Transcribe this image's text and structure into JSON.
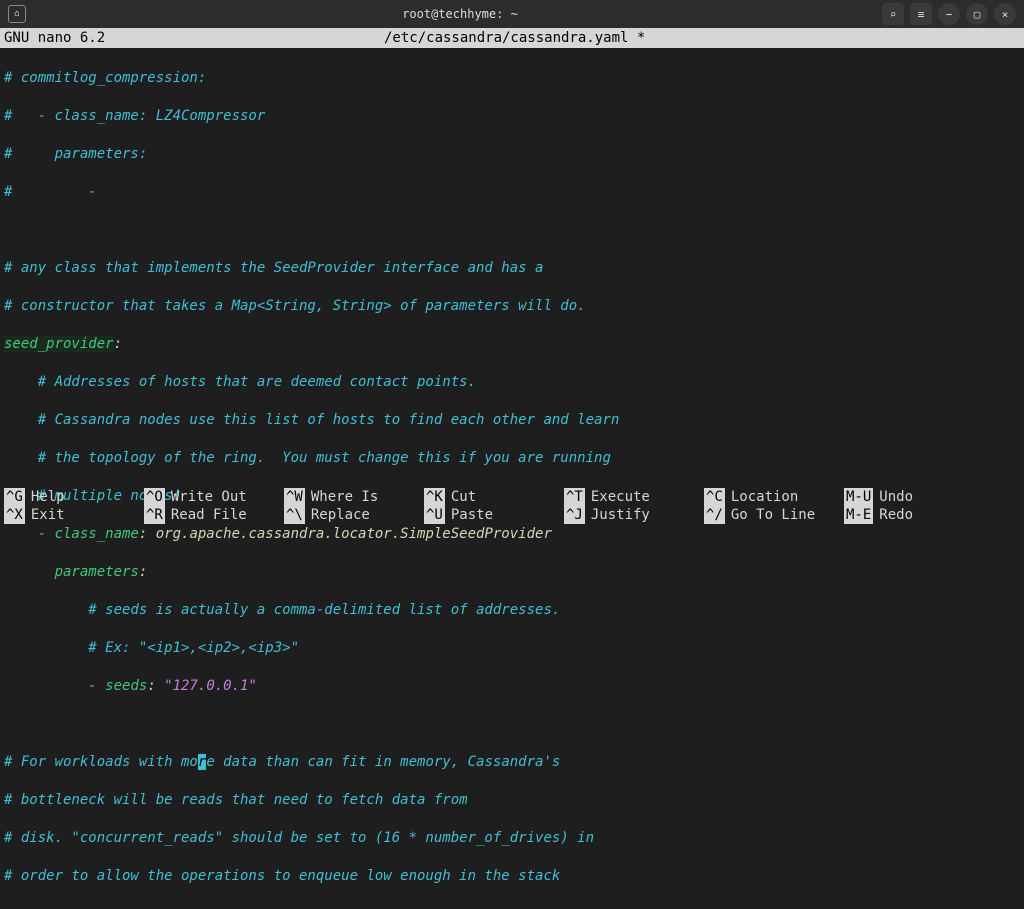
{
  "titlebar": {
    "window_title": "root@techhyme: ~"
  },
  "nano": {
    "app_version": " GNU nano 6.2",
    "file_path": "/etc/cassandra/cassandra.yaml *"
  },
  "lines": {
    "l1": "# commitlog_compression:",
    "l2": "#   - class_name: LZ4Compressor",
    "l3": "#     parameters:",
    "l4": "#         -",
    "l5": "",
    "l6": "# any class that implements the SeedProvider interface and has a",
    "l7": "# constructor that takes a Map<String, String> of parameters will do.",
    "l8_key": "seed_provider",
    "l8_colon": ":",
    "l9": "    # Addresses of hosts that are deemed contact points.",
    "l10": "    # Cassandra nodes use this list of hosts to find each other and learn",
    "l11": "    # the topology of the ring.  You must change this if you are running",
    "l12": "    # multiple nodes!",
    "l13_dash": "    - ",
    "l13_key": "class_name",
    "l13_colon": ": ",
    "l13_val": "org.apache.cassandra.locator.SimpleSeedProvider",
    "l14_pad": "      ",
    "l14_key": "parameters",
    "l14_colon": ":",
    "l15": "          # seeds is actually a comma-delimited list of addresses.",
    "l16": "          # Ex: \"<ip1>,<ip2>,<ip3>\"",
    "l17_dash": "          - ",
    "l17_key": "seeds",
    "l17_colon": ": ",
    "l17_val": "\"127.0.0.1\"",
    "l18": "",
    "l19a": "# For workloads with mo",
    "l19_cursor": "r",
    "l19b": "e data than can fit in memory, Cassandra's",
    "l20": "# bottleneck will be reads that need to fetch data from",
    "l21": "# disk. \"concurrent_reads\" should be set to (16 * number_of_drives) in",
    "l22": "# order to allow the operations to enqueue low enough in the stack"
  },
  "shortcuts": {
    "r1": [
      {
        "k": "^G",
        "l": "Help"
      },
      {
        "k": "^O",
        "l": "Write Out"
      },
      {
        "k": "^W",
        "l": "Where Is"
      },
      {
        "k": "^K",
        "l": "Cut"
      },
      {
        "k": "^T",
        "l": "Execute"
      },
      {
        "k": "^C",
        "l": "Location"
      },
      {
        "k": "M-U",
        "l": "Undo"
      }
    ],
    "r2": [
      {
        "k": "^X",
        "l": "Exit"
      },
      {
        "k": "^R",
        "l": "Read File"
      },
      {
        "k": "^\\",
        "l": "Replace"
      },
      {
        "k": "^U",
        "l": "Paste"
      },
      {
        "k": "^J",
        "l": "Justify"
      },
      {
        "k": "^/",
        "l": "Go To Line"
      },
      {
        "k": "M-E",
        "l": "Redo"
      }
    ]
  }
}
